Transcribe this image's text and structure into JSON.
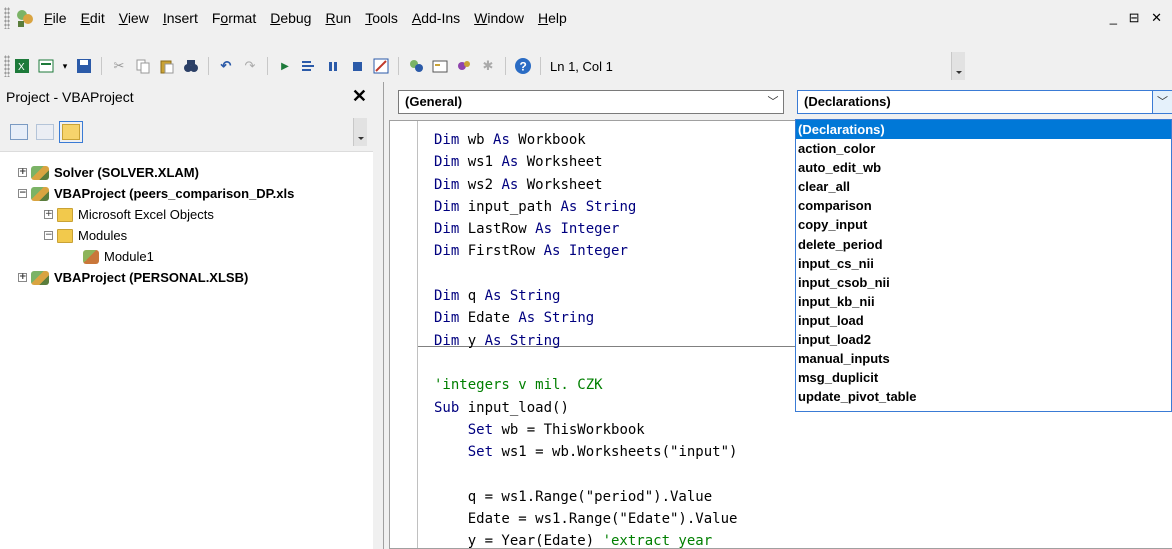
{
  "menu": {
    "items": [
      {
        "key": "F",
        "rest": "ile"
      },
      {
        "key": "E",
        "rest": "dit"
      },
      {
        "key": "V",
        "rest": "iew"
      },
      {
        "key": "I",
        "rest": "nsert"
      },
      {
        "pre": "F",
        "key": "o",
        "rest": "rmat"
      },
      {
        "key": "D",
        "rest": "ebug"
      },
      {
        "key": "R",
        "rest": "un"
      },
      {
        "key": "T",
        "rest": "ools"
      },
      {
        "key": "A",
        "rest": "dd-Ins"
      },
      {
        "key": "W",
        "rest": "indow"
      },
      {
        "key": "H",
        "rest": "elp"
      }
    ],
    "window_controls": "_ ⊟ ✕"
  },
  "toolbar": {
    "position_label": "Ln 1, Col 1"
  },
  "project": {
    "title": "Project - VBAProject",
    "close_glyph": "✕",
    "tree": [
      {
        "label": "Solver (SOLVER.XLAM)",
        "bold": true,
        "indent": 0,
        "exp": "+",
        "icon": "proj"
      },
      {
        "label": "VBAProject (peers_comparison_DP.xls",
        "bold": true,
        "indent": 0,
        "exp": "−",
        "icon": "proj"
      },
      {
        "label": "Microsoft Excel Objects",
        "bold": false,
        "indent": 1,
        "exp": "+",
        "icon": "fold"
      },
      {
        "label": "Modules",
        "bold": false,
        "indent": 1,
        "exp": "−",
        "icon": "fold"
      },
      {
        "label": "Module1",
        "bold": false,
        "indent": 2,
        "exp": "",
        "icon": "mod",
        "selected": true
      },
      {
        "label": "VBAProject (PERSONAL.XLSB)",
        "bold": true,
        "indent": 0,
        "exp": "+",
        "icon": "proj"
      }
    ]
  },
  "code_window": {
    "object_combo": "(General)",
    "procedure_combo": "(Declarations)",
    "lines": [
      [
        {
          "t": "Dim",
          "c": "kw"
        },
        {
          "t": " wb ",
          "c": "plain"
        },
        {
          "t": "As",
          "c": "kw"
        },
        {
          "t": " Workbook",
          "c": "plain"
        }
      ],
      [
        {
          "t": "Dim",
          "c": "kw"
        },
        {
          "t": " ws1 ",
          "c": "plain"
        },
        {
          "t": "As",
          "c": "kw"
        },
        {
          "t": " Worksheet",
          "c": "plain"
        }
      ],
      [
        {
          "t": "Dim",
          "c": "kw"
        },
        {
          "t": " ws2 ",
          "c": "plain"
        },
        {
          "t": "As",
          "c": "kw"
        },
        {
          "t": " Worksheet",
          "c": "plain"
        }
      ],
      [
        {
          "t": "Dim",
          "c": "kw"
        },
        {
          "t": " input_path ",
          "c": "plain"
        },
        {
          "t": "As String",
          "c": "kw"
        }
      ],
      [
        {
          "t": "Dim",
          "c": "kw"
        },
        {
          "t": " LastRow ",
          "c": "plain"
        },
        {
          "t": "As Integer",
          "c": "kw"
        }
      ],
      [
        {
          "t": "Dim",
          "c": "kw"
        },
        {
          "t": " FirstRow ",
          "c": "plain"
        },
        {
          "t": "As Integer",
          "c": "kw"
        }
      ],
      [],
      [
        {
          "t": "Dim",
          "c": "kw"
        },
        {
          "t": " q ",
          "c": "plain"
        },
        {
          "t": "As String",
          "c": "kw"
        }
      ],
      [
        {
          "t": "Dim",
          "c": "kw"
        },
        {
          "t": " Edate ",
          "c": "plain"
        },
        {
          "t": "As String",
          "c": "kw"
        }
      ],
      [
        {
          "t": "Dim",
          "c": "kw"
        },
        {
          "t": " y ",
          "c": "plain"
        },
        {
          "t": "As String",
          "c": "kw"
        }
      ],
      [],
      [
        {
          "t": "'integers v mil. CZK",
          "c": "cm"
        }
      ],
      [
        {
          "t": "Sub",
          "c": "kw"
        },
        {
          "t": " input_load()",
          "c": "plain"
        }
      ],
      [
        {
          "t": "    ",
          "c": "plain"
        },
        {
          "t": "Set",
          "c": "kw"
        },
        {
          "t": " wb = ThisWorkbook",
          "c": "plain"
        }
      ],
      [
        {
          "t": "    ",
          "c": "plain"
        },
        {
          "t": "Set",
          "c": "kw"
        },
        {
          "t": " ws1 = wb.Worksheets(\"input\")",
          "c": "plain"
        }
      ],
      [],
      [
        {
          "t": "    q = ws1.Range(\"period\").Value",
          "c": "plain"
        }
      ],
      [
        {
          "t": "    Edate = ws1.Range(\"Edate\").Value",
          "c": "plain"
        }
      ],
      [
        {
          "t": "    y = Year(Edate) ",
          "c": "plain"
        },
        {
          "t": "'extract year",
          "c": "cm"
        }
      ]
    ]
  },
  "procedure_dropdown": {
    "items": [
      "(Declarations)",
      "action_color",
      "auto_edit_wb",
      "clear_all",
      "comparison",
      "copy_input",
      "delete_period",
      "input_cs_nii",
      "input_csob_nii",
      "input_kb_nii",
      "input_load",
      "input_load2",
      "manual_inputs",
      "msg_duplicit",
      "update_pivot_table"
    ],
    "selected": "(Declarations)"
  }
}
